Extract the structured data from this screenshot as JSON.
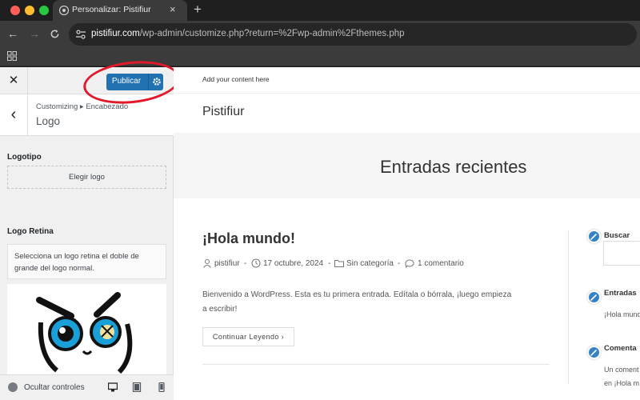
{
  "browser": {
    "tab_title": "Personalizar: Pistifiur",
    "url_host": "pistifiur.com",
    "url_path": "/wp-admin/customize.php?return=%2Fwp-admin%2Fthemes.php",
    "tab_close": "×",
    "new_tab": "+"
  },
  "customizer": {
    "close": "✕",
    "publish_label": "Publicar",
    "back": "‹",
    "breadcrumb": "Customizing ▸ Encabezado",
    "section_title": "Logo",
    "logo_label": "Logotipo",
    "choose_logo": "Elegir logo",
    "retina_label": "Logo Retina",
    "retina_description": "Selecciona un logo retina el doble de grande del logo normal.",
    "hide_controls": "Ocultar controles"
  },
  "preview": {
    "topbar_text": "Add your content here",
    "site_title": "Pistifiur",
    "hero_title": "Entradas recientes",
    "post_title": "¡Hola mundo!",
    "post_author": "pistifiur",
    "post_date": "17 octubre, 2024",
    "post_category": "Sin categoría",
    "post_comments": "1 comentario",
    "meta_sep": "-",
    "excerpt": "Bienvenido a WordPress. Esta es tu primera entrada. Edítala o bórrala, ¡luego empieza a escribir!",
    "read_more": "Continuar Leyendo  ›",
    "widgets": {
      "search_title": "Buscar",
      "entries_title": "Entradas",
      "entries_item": "¡Hola mund",
      "comments_title": "Comenta",
      "comments_line1": "Un coment",
      "comments_line2": "en ¡Hola m"
    }
  },
  "colors": {
    "publish_button": "#2271b1",
    "annotation_circle": "#e11a2b",
    "edit_shortcut": "#3582c4"
  }
}
